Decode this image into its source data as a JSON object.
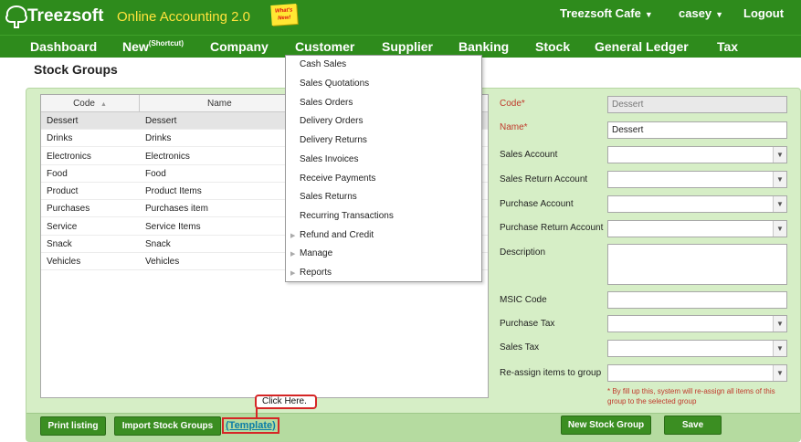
{
  "header": {
    "logo_text": "Treezsoft",
    "app_title": "Online Accounting 2.0",
    "sticky_note": "What's New!",
    "company": "Treezsoft Cafe",
    "user": "casey",
    "logout": "Logout"
  },
  "nav": {
    "dashboard": "Dashboard",
    "new": "New",
    "new_sup": "(Shortcut)",
    "company": "Company",
    "customer": "Customer",
    "supplier": "Supplier",
    "banking": "Banking",
    "stock": "Stock",
    "general_ledger": "General Ledger",
    "tax": "Tax"
  },
  "page_title": "Stock Groups",
  "grid": {
    "columns": [
      "Code",
      "Name"
    ],
    "rows": [
      {
        "code": "Dessert",
        "name": "Dessert"
      },
      {
        "code": "Drinks",
        "name": "Drinks"
      },
      {
        "code": "Electronics",
        "name": "Electronics"
      },
      {
        "code": "Food",
        "name": "Food"
      },
      {
        "code": "Product",
        "name": "Product Items"
      },
      {
        "code": "Purchases",
        "name": "Purchases item"
      },
      {
        "code": "Service",
        "name": "Service Items"
      },
      {
        "code": "Snack",
        "name": "Snack"
      },
      {
        "code": "Vehicles",
        "name": "Vehicles"
      }
    ]
  },
  "customer_menu": {
    "items": [
      "Cash Sales",
      "Sales Quotations",
      "Sales Orders",
      "Delivery Orders",
      "Delivery Returns",
      "Sales Invoices",
      "Receive Payments",
      "Sales Returns",
      "Recurring Transactions",
      "Refund and Credit",
      "Manage",
      "Reports"
    ]
  },
  "form": {
    "code_label": "Code*",
    "code_value": "Dessert",
    "name_label": "Name*",
    "name_value": "Dessert",
    "sales_account": "Sales Account",
    "sales_return_account": "Sales Return Account",
    "purchase_account": "Purchase Account",
    "purchase_return_account": "Purchase Return Account",
    "description": "Description",
    "msic_code": "MSIC Code",
    "purchase_tax": "Purchase Tax",
    "sales_tax": "Sales Tax",
    "reassign": "Re-assign items to group",
    "note": "* By fill up this, system will re-assign all items of this group to the selected group"
  },
  "buttons": {
    "print_listing": "Print listing",
    "import_stock_groups": "Import Stock Groups",
    "template_link": "(Template)",
    "click_here": "Click Here.",
    "new_stock_group": "New Stock Group",
    "save": "Save"
  },
  "colors": {
    "header_green": "#2e8b1c",
    "app_title_yellow": "#ffe33c",
    "panel_green": "#d6eec6",
    "required_red": "#c0392b",
    "highlight_red": "#d52626"
  }
}
